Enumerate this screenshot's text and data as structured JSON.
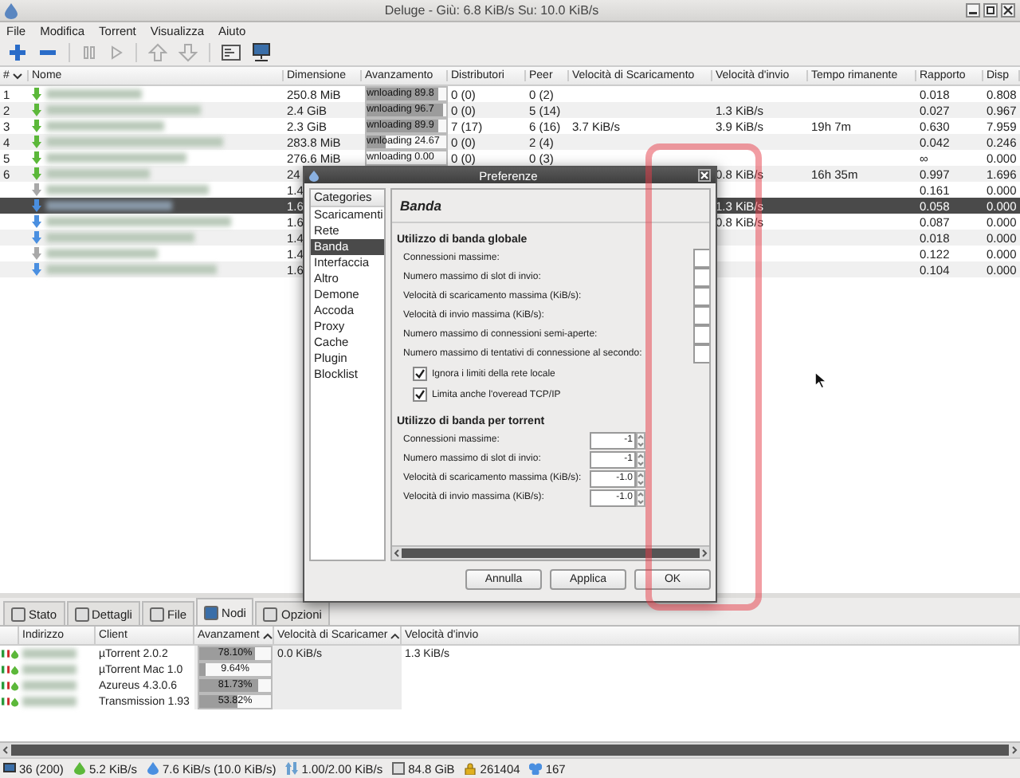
{
  "window": {
    "title": "Deluge - Giù: 6.8 KiB/s Su: 10.0 KiB/s"
  },
  "menu": [
    "File",
    "Modifica",
    "Torrent",
    "Visualizza",
    "Aiuto"
  ],
  "torrent_table": {
    "columns": [
      "#",
      "Nome",
      "Dimensione",
      "Avanzamento",
      "Distributori",
      "Peer",
      "Velocità di Scaricamento",
      "Velocità d'invio",
      "Tempo rimanente",
      "Rapporto",
      "Disp"
    ],
    "rows": [
      {
        "number": "1",
        "kind": "downloading",
        "selected": false,
        "size": "250.8 MiB",
        "progress": {
          "text": "wnloading 89.8",
          "level": 0.898
        },
        "seeds": "0 (0)",
        "peers": "0 (2)",
        "ratio": "0.018",
        "avail": "0.808"
      },
      {
        "number": "2",
        "kind": "downloading",
        "selected": false,
        "size": "2.4 GiB",
        "progress": {
          "text": "wnloading 96.7",
          "level": 0.967
        },
        "seeds": "0 (0)",
        "peers": "5 (14)",
        "up": "1.3 KiB/s",
        "ratio": "0.027",
        "avail": "0.967"
      },
      {
        "number": "3",
        "kind": "downloading",
        "selected": false,
        "size": "2.3 GiB",
        "progress": {
          "text": "wnloading 89.9",
          "level": 0.899
        },
        "seeds": "7 (17)",
        "peers": "6 (16)",
        "down": "3.7 KiB/s",
        "up": "3.9 KiB/s",
        "eta": "19h 7m",
        "ratio": "0.630",
        "avail": "7.959"
      },
      {
        "number": "4",
        "kind": "downloading",
        "selected": false,
        "size": "283.8 MiB",
        "progress": {
          "text": "wnloading 24.67",
          "level": 0.2467
        },
        "seeds": "0 (0)",
        "peers": "2 (4)",
        "ratio": "0.042",
        "avail": "0.246"
      },
      {
        "number": "5",
        "kind": "downloading",
        "selected": false,
        "size": "276.6 MiB",
        "progress": {
          "text": "wnloading 0.00",
          "level": 0
        },
        "seeds": "0 (0)",
        "peers": "0 (3)",
        "ratio": "∞",
        "avail": "0.000"
      },
      {
        "number": "6",
        "kind": "downloading",
        "selected": false,
        "size": "24",
        "up": "0.8 KiB/s",
        "eta": "16h 35m",
        "ratio": "0.997",
        "avail": "1.696"
      },
      {
        "kind": "paused",
        "selected": false,
        "size": "1.4",
        "ratio": "0.161",
        "avail": "0.000"
      },
      {
        "kind": "seeding",
        "selected": true,
        "size": "1.6",
        "up": "1.3 KiB/s",
        "ratio": "0.058",
        "avail": "0.000"
      },
      {
        "kind": "seeding",
        "selected": false,
        "size": "1.6",
        "up": "0.8 KiB/s",
        "ratio": "0.087",
        "avail": "0.000"
      },
      {
        "kind": "seeding",
        "selected": false,
        "size": "1.4",
        "ratio": "0.018",
        "avail": "0.000"
      },
      {
        "kind": "paused",
        "selected": false,
        "size": "1.4",
        "ratio": "0.122",
        "avail": "0.000"
      },
      {
        "kind": "seeding",
        "selected": false,
        "size": "1.6",
        "ratio": "0.104",
        "avail": "0.000"
      }
    ]
  },
  "preferences_dialog": {
    "title": "Preferenze",
    "categories_header": "Categories",
    "categories": [
      {
        "label": "Scaricamenti",
        "selected": false
      },
      {
        "label": "Rete",
        "selected": false
      },
      {
        "label": "Banda",
        "selected": true
      },
      {
        "label": "Interfaccia",
        "selected": false
      },
      {
        "label": "Altro",
        "selected": false
      },
      {
        "label": "Demone",
        "selected": false
      },
      {
        "label": "Accoda",
        "selected": false
      },
      {
        "label": "Proxy",
        "selected": false
      },
      {
        "label": "Cache",
        "selected": false
      },
      {
        "label": "Plugin",
        "selected": false
      },
      {
        "label": "Blocklist",
        "selected": false
      }
    ],
    "page_title": "Banda",
    "global_heading": "Utilizzo di banda globale",
    "global_fields": [
      "Connessioni massime:",
      "Numero massimo di slot di invio:",
      "Velocità di scaricamento massima (KiB/s):",
      "Velocità di invio massima (KiB/s):",
      "Numero massimo di connessioni semi-aperte:",
      "Numero massimo di tentativi di connessione al secondo:"
    ],
    "checkboxes": [
      {
        "label": "Ignora i limiti della rete locale",
        "checked": true
      },
      {
        "label": "Limita anche l'overead TCP/IP",
        "checked": true
      }
    ],
    "torrent_heading": "Utilizzo di banda per torrent",
    "torrent_fields": [
      {
        "label": "Connessioni massime:",
        "value": "-1"
      },
      {
        "label": "Numero massimo di slot di invio:",
        "value": "-1"
      },
      {
        "label": "Velocità di scaricamento massima (KiB/s):",
        "value": "-1.0"
      },
      {
        "label": "Velocità di invio massima (KiB/s):",
        "value": "-1.0"
      }
    ],
    "buttons": [
      "Annulla",
      "Applica",
      "OK"
    ]
  },
  "detail_tabs": [
    {
      "label": "Stato",
      "selected": false
    },
    {
      "label": "Dettagli",
      "selected": false
    },
    {
      "label": "File",
      "selected": false
    },
    {
      "label": "Nodi",
      "selected": true
    },
    {
      "label": "Opzioni",
      "selected": false
    }
  ],
  "peers": {
    "columns": [
      {
        "label": "Indirizzo",
        "sorted": false
      },
      {
        "label": "Client",
        "sorted": false
      },
      {
        "label": "Avanzament",
        "sorted": true
      },
      {
        "label": "Velocità di Scaricamer",
        "sorted": true
      },
      {
        "label": "Velocità d'invio",
        "sorted": false
      }
    ],
    "rows": [
      {
        "client": "µTorrent 2.0.2",
        "progress": {
          "text": "78.10%",
          "level": 0.781
        },
        "down": "0.0 KiB/s",
        "up": "1.3 KiB/s"
      },
      {
        "client": "µTorrent Mac 1.0",
        "progress": {
          "text": "9.64%",
          "level": 0.0964
        }
      },
      {
        "client": "Azureus 4.3.0.6",
        "progress": {
          "text": "81.73%",
          "level": 0.8173
        }
      },
      {
        "client": "Transmission 1.93",
        "progress": {
          "text": "53.82%",
          "level": 0.5382
        }
      }
    ]
  },
  "status_bar": [
    {
      "kind": "connections",
      "text": "36 (200)"
    },
    {
      "kind": "download",
      "text": "5.2 KiB/s"
    },
    {
      "kind": "upload",
      "text": "7.6 KiB/s (10.0 KiB/s)"
    },
    {
      "kind": "protocol",
      "text": "1.00/2.00 KiB/s"
    },
    {
      "kind": "disk",
      "text": "84.8 GiB"
    },
    {
      "kind": "ip",
      "text": "261404"
    },
    {
      "kind": "dht",
      "text": "167"
    }
  ]
}
